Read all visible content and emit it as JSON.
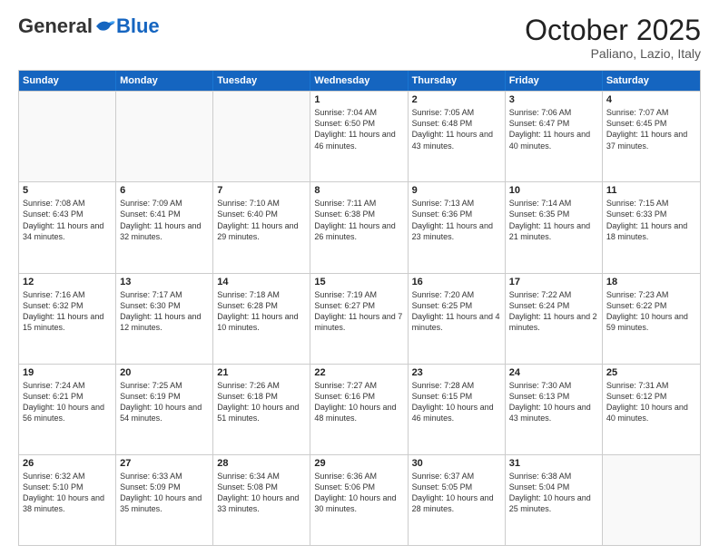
{
  "header": {
    "logo_general": "General",
    "logo_blue": "Blue",
    "month_title": "October 2025",
    "location": "Paliano, Lazio, Italy"
  },
  "weekdays": [
    "Sunday",
    "Monday",
    "Tuesday",
    "Wednesday",
    "Thursday",
    "Friday",
    "Saturday"
  ],
  "rows": [
    [
      {
        "day": "",
        "text": ""
      },
      {
        "day": "",
        "text": ""
      },
      {
        "day": "",
        "text": ""
      },
      {
        "day": "1",
        "text": "Sunrise: 7:04 AM\nSunset: 6:50 PM\nDaylight: 11 hours\nand 46 minutes."
      },
      {
        "day": "2",
        "text": "Sunrise: 7:05 AM\nSunset: 6:48 PM\nDaylight: 11 hours\nand 43 minutes."
      },
      {
        "day": "3",
        "text": "Sunrise: 7:06 AM\nSunset: 6:47 PM\nDaylight: 11 hours\nand 40 minutes."
      },
      {
        "day": "4",
        "text": "Sunrise: 7:07 AM\nSunset: 6:45 PM\nDaylight: 11 hours\nand 37 minutes."
      }
    ],
    [
      {
        "day": "5",
        "text": "Sunrise: 7:08 AM\nSunset: 6:43 PM\nDaylight: 11 hours\nand 34 minutes."
      },
      {
        "day": "6",
        "text": "Sunrise: 7:09 AM\nSunset: 6:41 PM\nDaylight: 11 hours\nand 32 minutes."
      },
      {
        "day": "7",
        "text": "Sunrise: 7:10 AM\nSunset: 6:40 PM\nDaylight: 11 hours\nand 29 minutes."
      },
      {
        "day": "8",
        "text": "Sunrise: 7:11 AM\nSunset: 6:38 PM\nDaylight: 11 hours\nand 26 minutes."
      },
      {
        "day": "9",
        "text": "Sunrise: 7:13 AM\nSunset: 6:36 PM\nDaylight: 11 hours\nand 23 minutes."
      },
      {
        "day": "10",
        "text": "Sunrise: 7:14 AM\nSunset: 6:35 PM\nDaylight: 11 hours\nand 21 minutes."
      },
      {
        "day": "11",
        "text": "Sunrise: 7:15 AM\nSunset: 6:33 PM\nDaylight: 11 hours\nand 18 minutes."
      }
    ],
    [
      {
        "day": "12",
        "text": "Sunrise: 7:16 AM\nSunset: 6:32 PM\nDaylight: 11 hours\nand 15 minutes."
      },
      {
        "day": "13",
        "text": "Sunrise: 7:17 AM\nSunset: 6:30 PM\nDaylight: 11 hours\nand 12 minutes."
      },
      {
        "day": "14",
        "text": "Sunrise: 7:18 AM\nSunset: 6:28 PM\nDaylight: 11 hours\nand 10 minutes."
      },
      {
        "day": "15",
        "text": "Sunrise: 7:19 AM\nSunset: 6:27 PM\nDaylight: 11 hours\nand 7 minutes."
      },
      {
        "day": "16",
        "text": "Sunrise: 7:20 AM\nSunset: 6:25 PM\nDaylight: 11 hours\nand 4 minutes."
      },
      {
        "day": "17",
        "text": "Sunrise: 7:22 AM\nSunset: 6:24 PM\nDaylight: 11 hours\nand 2 minutes."
      },
      {
        "day": "18",
        "text": "Sunrise: 7:23 AM\nSunset: 6:22 PM\nDaylight: 10 hours\nand 59 minutes."
      }
    ],
    [
      {
        "day": "19",
        "text": "Sunrise: 7:24 AM\nSunset: 6:21 PM\nDaylight: 10 hours\nand 56 minutes."
      },
      {
        "day": "20",
        "text": "Sunrise: 7:25 AM\nSunset: 6:19 PM\nDaylight: 10 hours\nand 54 minutes."
      },
      {
        "day": "21",
        "text": "Sunrise: 7:26 AM\nSunset: 6:18 PM\nDaylight: 10 hours\nand 51 minutes."
      },
      {
        "day": "22",
        "text": "Sunrise: 7:27 AM\nSunset: 6:16 PM\nDaylight: 10 hours\nand 48 minutes."
      },
      {
        "day": "23",
        "text": "Sunrise: 7:28 AM\nSunset: 6:15 PM\nDaylight: 10 hours\nand 46 minutes."
      },
      {
        "day": "24",
        "text": "Sunrise: 7:30 AM\nSunset: 6:13 PM\nDaylight: 10 hours\nand 43 minutes."
      },
      {
        "day": "25",
        "text": "Sunrise: 7:31 AM\nSunset: 6:12 PM\nDaylight: 10 hours\nand 40 minutes."
      }
    ],
    [
      {
        "day": "26",
        "text": "Sunrise: 6:32 AM\nSunset: 5:10 PM\nDaylight: 10 hours\nand 38 minutes."
      },
      {
        "day": "27",
        "text": "Sunrise: 6:33 AM\nSunset: 5:09 PM\nDaylight: 10 hours\nand 35 minutes."
      },
      {
        "day": "28",
        "text": "Sunrise: 6:34 AM\nSunset: 5:08 PM\nDaylight: 10 hours\nand 33 minutes."
      },
      {
        "day": "29",
        "text": "Sunrise: 6:36 AM\nSunset: 5:06 PM\nDaylight: 10 hours\nand 30 minutes."
      },
      {
        "day": "30",
        "text": "Sunrise: 6:37 AM\nSunset: 5:05 PM\nDaylight: 10 hours\nand 28 minutes."
      },
      {
        "day": "31",
        "text": "Sunrise: 6:38 AM\nSunset: 5:04 PM\nDaylight: 10 hours\nand 25 minutes."
      },
      {
        "day": "",
        "text": ""
      }
    ]
  ]
}
